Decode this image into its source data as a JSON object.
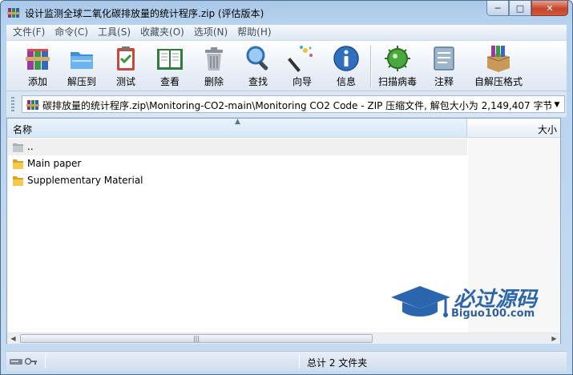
{
  "window": {
    "title": "设计监测全球二氧化碳排放量的统计程序.zip (评估版本)",
    "controls": {
      "minimize": "─",
      "maximize": "□",
      "close": "✕"
    }
  },
  "menu": {
    "items": [
      {
        "label": "文件(F)"
      },
      {
        "label": "命令(C)"
      },
      {
        "label": "工具(S)"
      },
      {
        "label": "收藏夹(O)"
      },
      {
        "label": "选项(N)"
      },
      {
        "label": "帮助(H)"
      }
    ]
  },
  "toolbar": {
    "buttons": [
      {
        "label": "添加",
        "icon": "books-add-icon"
      },
      {
        "label": "解压到",
        "icon": "folder-extract-icon"
      },
      {
        "label": "测试",
        "icon": "clipboard-check-icon"
      },
      {
        "label": "查看",
        "icon": "open-book-icon"
      },
      {
        "label": "删除",
        "icon": "trash-can-icon"
      },
      {
        "label": "查找",
        "icon": "magnifier-icon"
      },
      {
        "label": "向导",
        "icon": "magic-wand-icon"
      },
      {
        "label": "信息",
        "icon": "info-icon"
      },
      {
        "label": "扫描病毒",
        "icon": "virus-scan-icon"
      },
      {
        "label": "注释",
        "icon": "comment-icon"
      },
      {
        "label": "自解压格式",
        "icon": "sfx-box-icon"
      }
    ]
  },
  "address": {
    "path": "碳排放量的统计程序.zip\\Monitoring-CO2-main\\Monitoring CO2 Code - ZIP 压缩文件, 解包大小为 2,149,407 字节"
  },
  "filelist": {
    "columns": {
      "name": "名称",
      "size": "大小"
    },
    "rows": [
      {
        "name": "..",
        "type": "parent"
      },
      {
        "name": "Main paper",
        "type": "folder"
      },
      {
        "name": "Supplementary Material",
        "type": "folder"
      }
    ]
  },
  "watermark": {
    "title": "必过源码",
    "url": "Biguo100.com"
  },
  "status": {
    "text": "总计 2 文件夹"
  },
  "colors": {
    "titlebar": "#b7d3ef",
    "close_button": "#c7442a",
    "watermark": "#2b65ad"
  }
}
